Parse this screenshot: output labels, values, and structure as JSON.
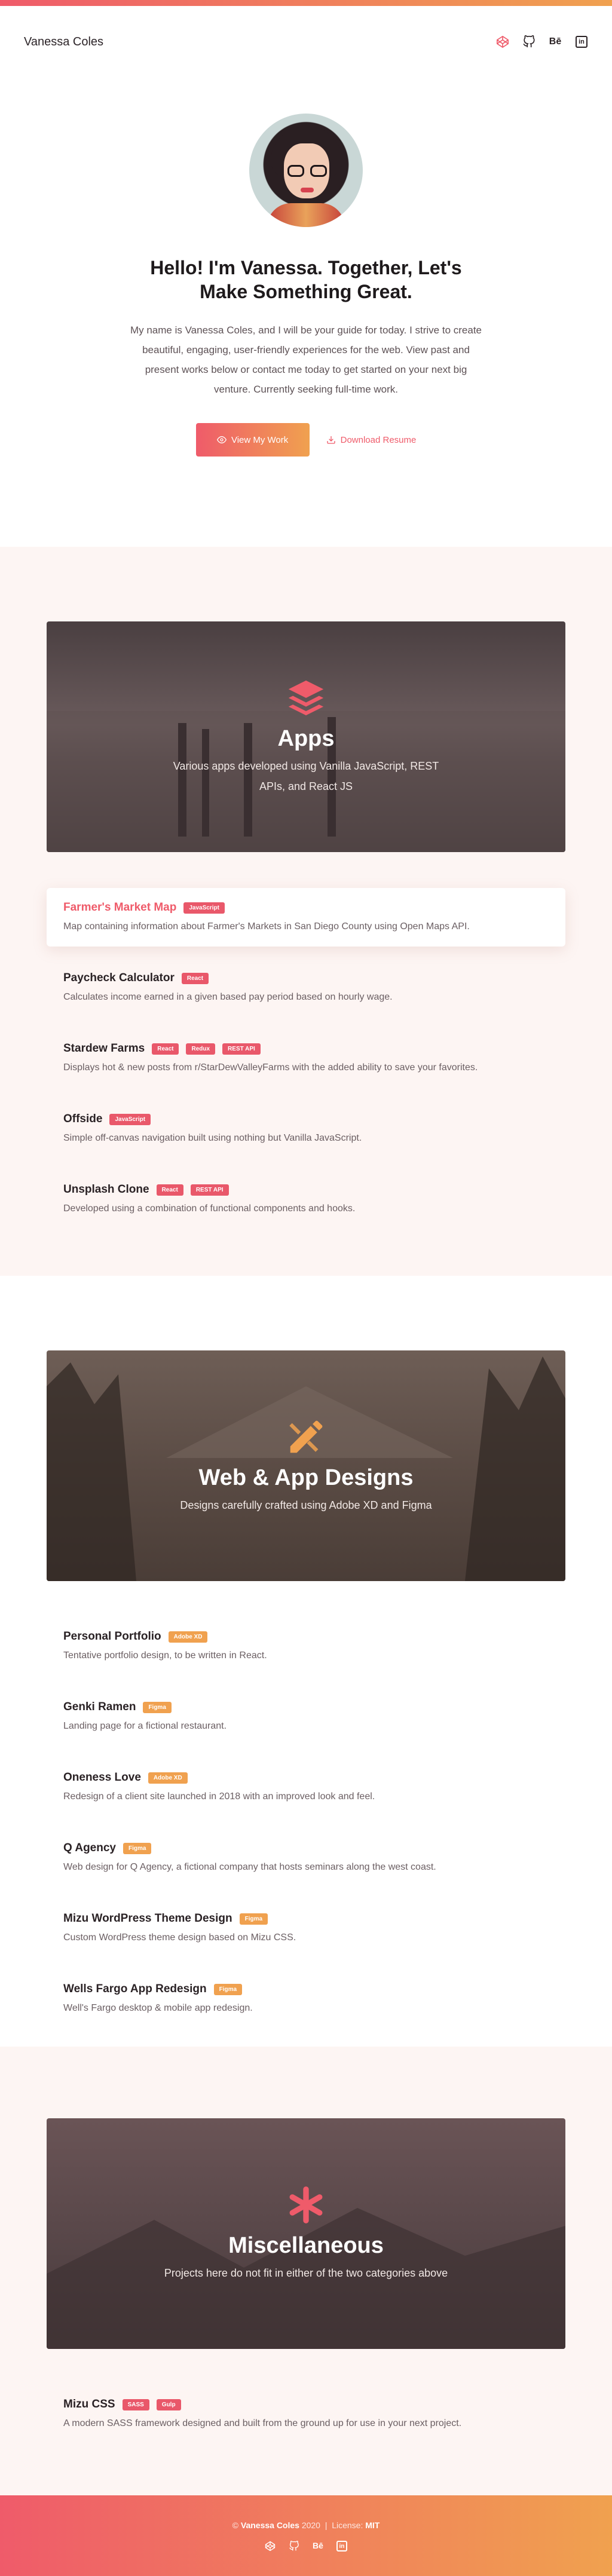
{
  "header": {
    "brand": "Vanessa Coles",
    "icons": [
      "codepen-icon",
      "github-icon",
      "behance-icon",
      "linkedin-icon"
    ],
    "behance_glyph": "Bē",
    "linkedin_glyph": "in"
  },
  "hero": {
    "title": "Hello!  I'm Vanessa.  Together, Let's Make Something Great.",
    "intro": "My name is Vanessa Coles, and I will be your guide for today.  I strive to create beautiful, engaging, user-friendly experiences for the web.  View past and present works below or contact me today to get started on your next big venture.  Currently seeking full-time work.",
    "primary_button": "View My Work",
    "secondary_button": "Download Resume"
  },
  "apps": {
    "title": "Apps",
    "subtitle": "Various apps developed using Vanilla JavaScript, REST APIs, and React JS",
    "items": [
      {
        "title": "Farmer's Market Map",
        "tags": [
          "JavaScript"
        ],
        "desc": "Map containing information about Farmer's Markets in San Diego County using Open Maps API."
      },
      {
        "title": "Paycheck Calculator",
        "tags": [
          "React"
        ],
        "desc": "Calculates income earned in a given based pay period based on hourly wage."
      },
      {
        "title": "Stardew Farms",
        "tags": [
          "React",
          "Redux",
          "REST API"
        ],
        "desc": "Displays hot & new posts from r/StarDewValleyFarms with the added ability to save your favorites."
      },
      {
        "title": "Offside",
        "tags": [
          "JavaScript"
        ],
        "desc": "Simple off-canvas navigation built using nothing but Vanilla JavaScript."
      },
      {
        "title": "Unsplash Clone",
        "tags": [
          "React",
          "REST API"
        ],
        "desc": "Developed using a combination of functional components and hooks."
      }
    ]
  },
  "designs": {
    "title": "Web & App Designs",
    "subtitle": "Designs carefully crafted using Adobe XD and Figma",
    "items": [
      {
        "title": "Personal Portfolio",
        "tags": [
          "Adobe XD"
        ],
        "desc": "Tentative portfolio design, to be written in React."
      },
      {
        "title": "Genki Ramen",
        "tags": [
          "Figma"
        ],
        "desc": "Landing page for a fictional restaurant."
      },
      {
        "title": "Oneness Love",
        "tags": [
          "Adobe XD"
        ],
        "desc": "Redesign of a client site launched in 2018 with an improved look and feel."
      },
      {
        "title": "Q Agency",
        "tags": [
          "Figma"
        ],
        "desc": "Web design for Q Agency, a fictional company that hosts seminars along the west coast."
      },
      {
        "title": "Mizu WordPress Theme Design",
        "tags": [
          "Figma"
        ],
        "desc": "Custom WordPress theme design based on Mizu CSS."
      },
      {
        "title": "Wells Fargo App Redesign",
        "tags": [
          "Figma"
        ],
        "desc": "Well's Fargo desktop & mobile app redesign."
      }
    ]
  },
  "misc": {
    "title": "Miscellaneous",
    "subtitle": "Projects here do not fit in either of the two categories above",
    "items": [
      {
        "title": "Mizu CSS",
        "tags": [
          "SASS",
          "Gulp"
        ],
        "desc": "A modern SASS framework designed and built from the ground up for use in your next project."
      }
    ]
  },
  "footer": {
    "copyright_symbol": "©",
    "name": "Vanessa Coles",
    "year": "2020",
    "separator": "|",
    "license_label": "License:",
    "license": "MIT"
  },
  "colors": {
    "accent": "#ef5b6a",
    "accent2": "#f0a14f",
    "tag_red": "#e9586a",
    "tag_orange": "#f0a14f"
  }
}
